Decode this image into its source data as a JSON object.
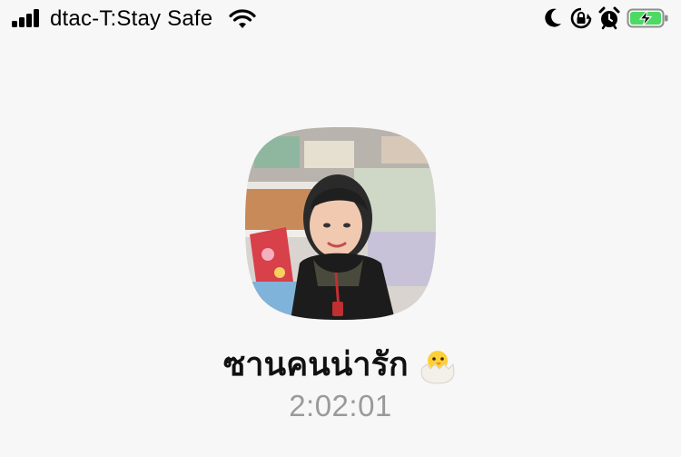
{
  "status_bar": {
    "carrier": "dtac-T:Stay Safe",
    "icons": [
      "signal-bars-icon",
      "wifi-icon",
      "moon-icon",
      "rotation-lock-icon",
      "alarm-clock-icon",
      "battery-charging-icon"
    ],
    "battery_color": "#4cd964"
  },
  "call": {
    "contact_name": "ซานคนน่ารัก",
    "name_emoji": "hatching-chick-icon",
    "duration": "2:02:01"
  },
  "colors": {
    "background": "#f7f7f7",
    "name_text": "#111111",
    "duration_text": "#9a9a9a"
  }
}
